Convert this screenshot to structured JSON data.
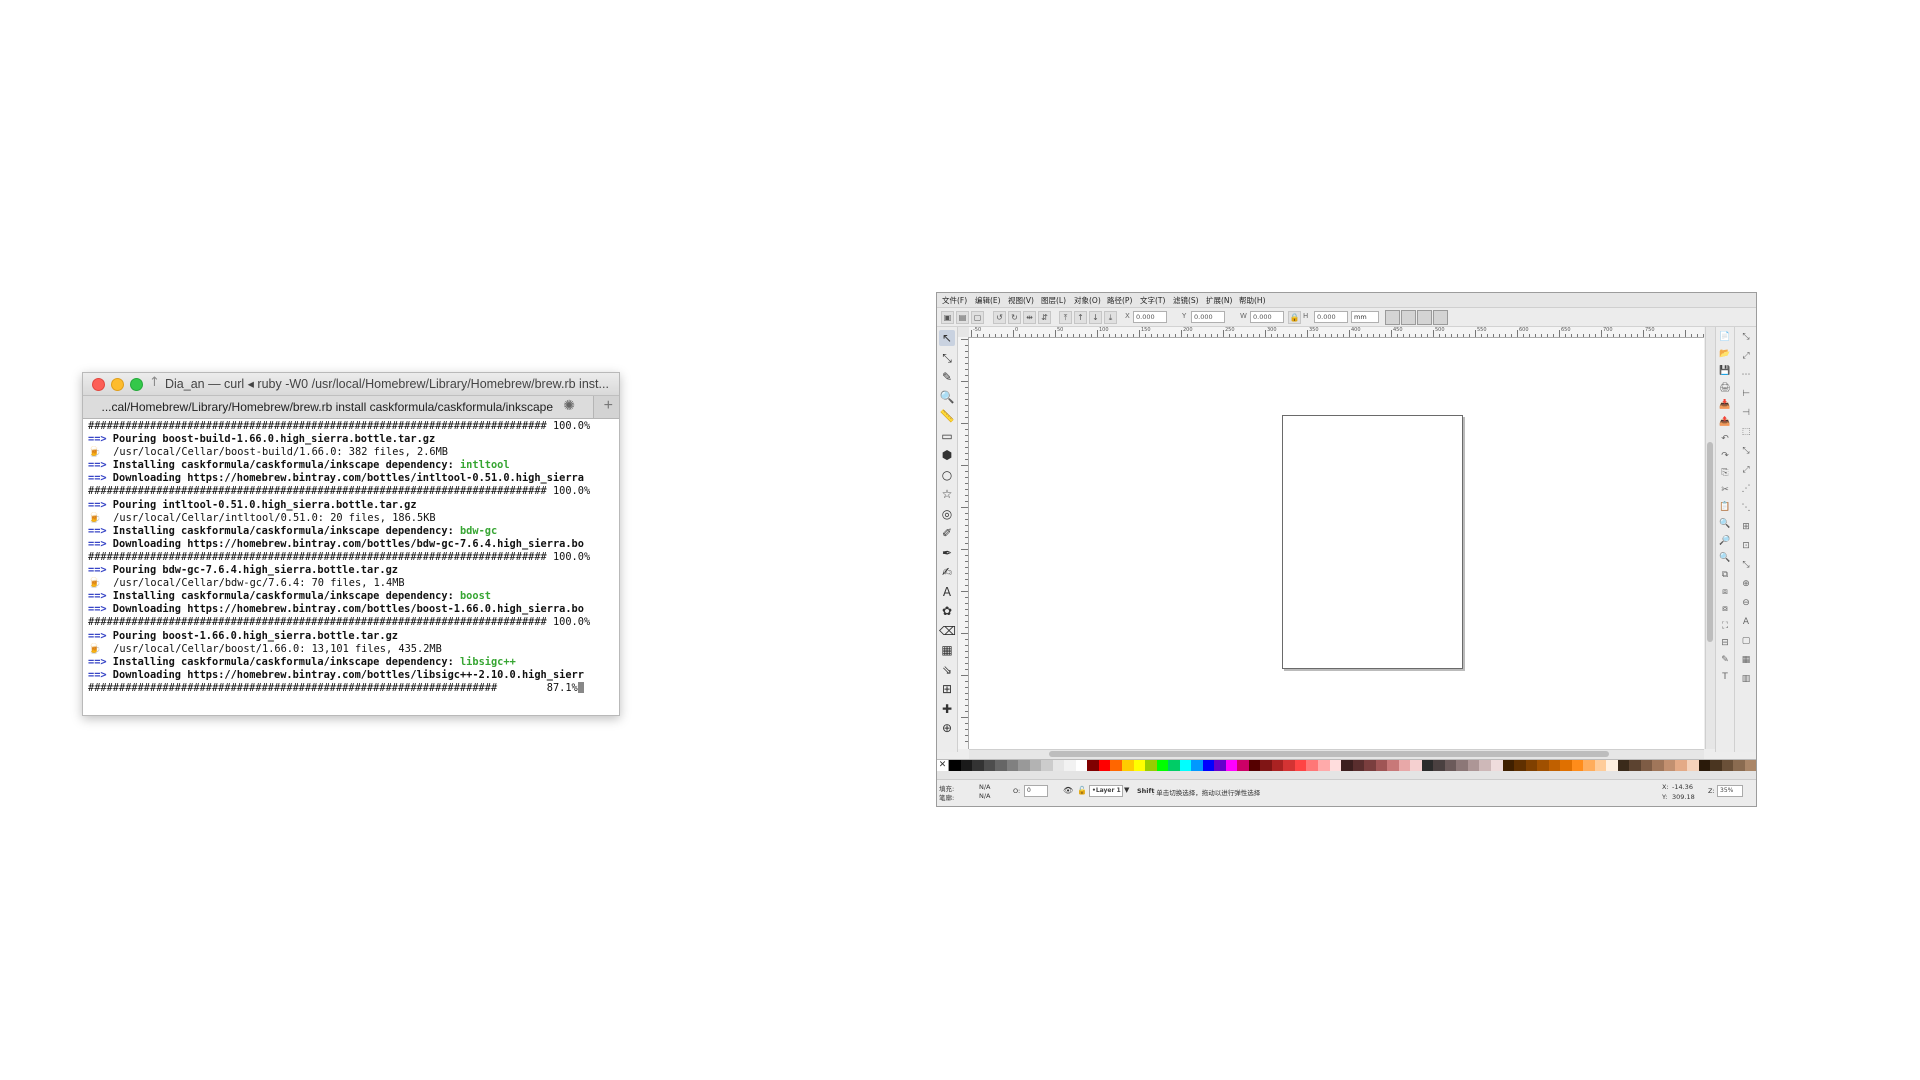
{
  "terminal": {
    "title": "Dia_an — curl ◂ ruby -W0 /usr/local/Homebrew/Library/Homebrew/brew.rb inst...",
    "tab_label": "...cal/Homebrew/Library/Homebrew/brew.rb install caskformula/caskformula/inkscape",
    "home_icon": "↑",
    "spinner_icon": "✺",
    "newtab_label": "+",
    "lines": [
      {
        "a": "",
        "b": "",
        "c": "########################################################################## 100.0%"
      },
      {
        "a": "==>",
        "b": " Pouring boost-build-1.66.0.high_sierra.bottle.tar.gz",
        "c": ""
      },
      {
        "a": "🍺",
        "b": "",
        "c": "  /usr/local/Cellar/boost-build/1.66.0: 382 files, 2.6MB"
      },
      {
        "a": "==>",
        "b": " Installing caskformula/caskformula/inkscape dependency: ",
        "g": "intltool"
      },
      {
        "a": "==>",
        "b": " Downloading https://homebrew.bintray.com/bottles/intltool-0.51.0.high_sierra",
        "c": ""
      },
      {
        "a": "",
        "b": "",
        "c": "########################################################################## 100.0%"
      },
      {
        "a": "==>",
        "b": " Pouring intltool-0.51.0.high_sierra.bottle.tar.gz",
        "c": ""
      },
      {
        "a": "🍺",
        "b": "",
        "c": "  /usr/local/Cellar/intltool/0.51.0: 20 files, 186.5KB"
      },
      {
        "a": "==>",
        "b": " Installing caskformula/caskformula/inkscape dependency: ",
        "g": "bdw-gc"
      },
      {
        "a": "==>",
        "b": " Downloading https://homebrew.bintray.com/bottles/bdw-gc-7.6.4.high_sierra.bo",
        "c": ""
      },
      {
        "a": "",
        "b": "",
        "c": "########################################################################## 100.0%"
      },
      {
        "a": "==>",
        "b": " Pouring bdw-gc-7.6.4.high_sierra.bottle.tar.gz",
        "c": ""
      },
      {
        "a": "🍺",
        "b": "",
        "c": "  /usr/local/Cellar/bdw-gc/7.6.4: 70 files, 1.4MB"
      },
      {
        "a": "==>",
        "b": " Installing caskformula/caskformula/inkscape dependency: ",
        "g": "boost"
      },
      {
        "a": "==>",
        "b": " Downloading https://homebrew.bintray.com/bottles/boost-1.66.0.high_sierra.bo",
        "c": ""
      },
      {
        "a": "",
        "b": "",
        "c": "########################################################################## 100.0%"
      },
      {
        "a": "==>",
        "b": " Pouring boost-1.66.0.high_sierra.bottle.tar.gz",
        "c": ""
      },
      {
        "a": "🍺",
        "b": "",
        "c": "  /usr/local/Cellar/boost/1.66.0: 13,101 files, 435.2MB"
      },
      {
        "a": "==>",
        "b": " Installing caskformula/caskformula/inkscape dependency: ",
        "g": "libsigc++"
      },
      {
        "a": "==>",
        "b": " Downloading https://homebrew.bintray.com/bottles/libsigc++-2.10.0.high_sierr",
        "c": ""
      },
      {
        "a": "",
        "b": "",
        "c": "##################################################################        87.1%"
      }
    ]
  },
  "inkscape": {
    "menu": [
      "文件(F)",
      "编辑(E)",
      "视图(V)",
      "图层(L)",
      "对象(O)",
      "路径(P)",
      "文字(T)",
      "滤镜(S)",
      "扩展(N)",
      "帮助(H)"
    ],
    "toolbar": {
      "x_label": "X",
      "x_value": "0.000",
      "y_label": "Y",
      "y_value": "0.000",
      "w_label": "W",
      "w_value": "0.000",
      "h_label": "H",
      "h_value": "0.000",
      "unit": "mm"
    },
    "tools": [
      "↖",
      "⤡",
      "✎",
      "🔍",
      "📏",
      "▭",
      "⬢",
      "○",
      "☆",
      "◎",
      "✐",
      "✒",
      "✍",
      "A",
      "✿",
      "⌫",
      "▦",
      "⇘",
      "⊞",
      "✚",
      "⊕"
    ],
    "ruler_labels": [
      "-50",
      "0",
      "50",
      "100",
      "150",
      "200",
      "250",
      "300",
      "350",
      "400",
      "450",
      "500",
      "550",
      "600",
      "650",
      "700",
      "750"
    ],
    "status": {
      "fill_label": "填充:",
      "stroke_label": "笔廓:",
      "fill_value": "N/A",
      "stroke_value": "N/A",
      "opacity_label": "O:",
      "opacity_value": "0",
      "layer": "•Layer 1",
      "message_key": "Shift",
      "message": ": 单击切换选择，拖动以进行弹性选择",
      "x_label": "X:",
      "x_value": "-14.36",
      "y_label": "Y:",
      "y_value": "309.18",
      "zoom_label": "Z:",
      "zoom_value": "35%"
    },
    "palette_colors": [
      "#000000",
      "#1a1a1a",
      "#333333",
      "#4d4d4d",
      "#666666",
      "#808080",
      "#999999",
      "#b3b3b3",
      "#cccccc",
      "#e6e6e6",
      "#f2f2f2",
      "#ffffff",
      "#800000",
      "#ff0000",
      "#ff6600",
      "#ffcc00",
      "#ffff00",
      "#99cc00",
      "#00ff00",
      "#00cc66",
      "#00ffff",
      "#0099ff",
      "#0000ff",
      "#6600cc",
      "#ff00ff",
      "#cc0066",
      "#550000",
      "#801515",
      "#aa2222",
      "#d43333",
      "#ff4444",
      "#ff7777",
      "#ffaaaa",
      "#ffdddd",
      "#3d1f1f",
      "#5a2e2e",
      "#7a3e3e",
      "#a05555",
      "#c87878",
      "#e8a8a8",
      "#f5d0d0",
      "#2b2b2b",
      "#4a4040",
      "#6b5a5a",
      "#8c7777",
      "#ad9696",
      "#ceb8b8",
      "#efdcdc",
      "#402000",
      "#603000",
      "#804000",
      "#a05000",
      "#c06000",
      "#e07000",
      "#ff8c1a",
      "#ffad5c",
      "#ffcc99",
      "#fff0e0",
      "#3a2a1a",
      "#5c4330",
      "#7e5c45",
      "#a0765a",
      "#c29070",
      "#e4aa86",
      "#f5d2ba",
      "#2a1a0a",
      "#4a3520",
      "#6a5038",
      "#8a6b50",
      "#aa8668"
    ]
  }
}
